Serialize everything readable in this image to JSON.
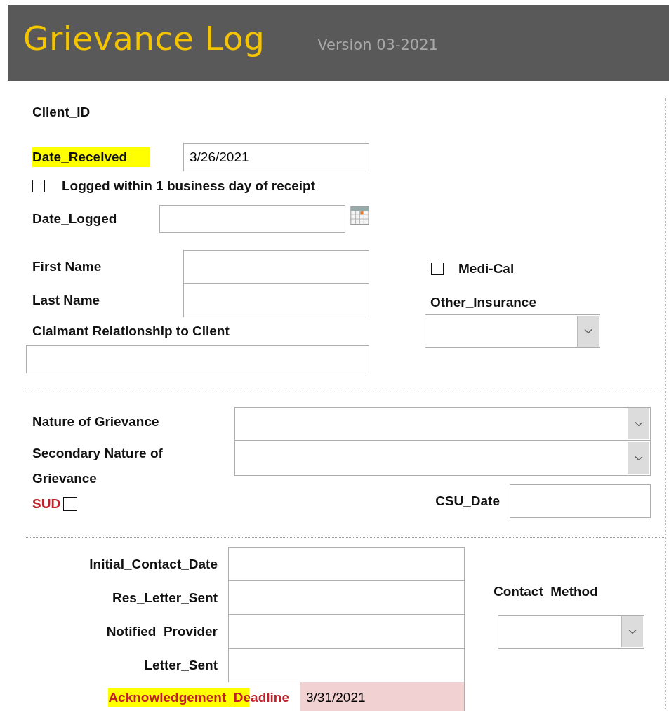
{
  "header": {
    "title": "Grievance Log",
    "version": "Version 03-2021"
  },
  "client_id": {
    "label": "Client_ID"
  },
  "date_received": {
    "label": "Date_Received",
    "value": "3/26/2021",
    "highlighted": true
  },
  "logged_within": {
    "label": "Logged within 1 business day of receipt",
    "checked": false
  },
  "date_logged": {
    "label": "Date_Logged"
  },
  "first_name": {
    "label": "First Name"
  },
  "last_name": {
    "label": "Last Name"
  },
  "claimant_relationship": {
    "label": "Claimant Relationship to Client"
  },
  "medi_cal": {
    "label": "Medi-Cal",
    "checked": false
  },
  "other_insurance": {
    "label": "Other_Insurance"
  },
  "nature": {
    "label": "Nature of Grievance"
  },
  "secondary_nature": {
    "label": "Secondary Nature of Grievance"
  },
  "sud": {
    "label": "SUD",
    "checked": false,
    "alert": true
  },
  "csu_date": {
    "label": "CSU_Date"
  },
  "contact_dates": [
    {
      "label": "Initial_Contact_Date"
    },
    {
      "label": "Res_Letter_Sent"
    },
    {
      "label": "Notified_Provider"
    },
    {
      "label": "Letter_Sent"
    }
  ],
  "contact_method": {
    "label": "Contact_Method"
  },
  "acknowledgement_deadline": {
    "label": "Acknowledgement_Deadline",
    "value": "3/31/2021",
    "highlighted": true,
    "alert": true
  }
}
